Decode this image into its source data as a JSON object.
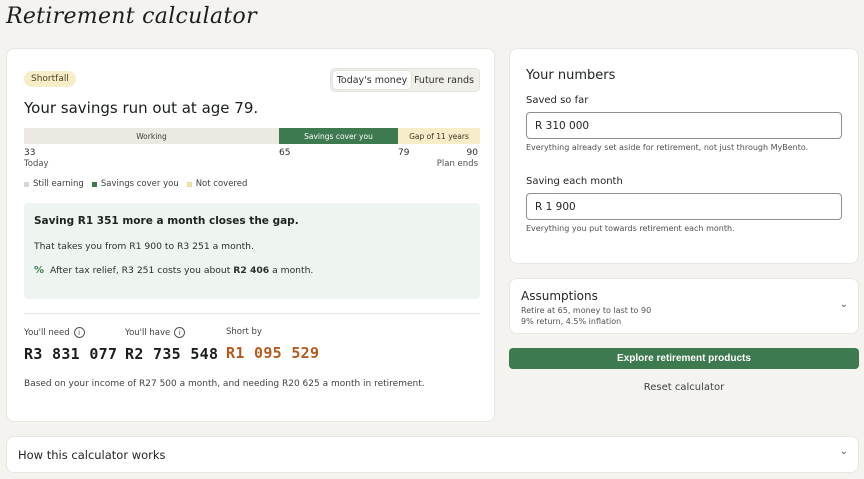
{
  "page": {
    "title": "Retirement calculator"
  },
  "main": {
    "badge": "Shortfall",
    "toggle": {
      "today": "Today's money",
      "future": "Future rands"
    },
    "headline": "Your savings run out at age 79.",
    "timeline": {
      "working_label": "Working",
      "cover_label": "Savings cover you",
      "gap_label": "Gap of 11 years",
      "ticks": {
        "start": "33",
        "start_sub": "Today",
        "retire": "65",
        "runout": "79",
        "end": "90",
        "end_sub": "Plan ends"
      }
    },
    "legend": {
      "earning": "Still earning",
      "cover": "Savings cover you",
      "notcovered": "Not covered"
    },
    "gap": {
      "title": "Saving R1 351 more a month closes the gap.",
      "line": "That takes you from R1 900 to R3 251 a month.",
      "tax_prefix": "After tax relief, R3 251 costs you about",
      "tax_amount": "R2 406",
      "tax_suffix": "a month."
    },
    "stats": {
      "need_label": "You'll need",
      "need_value": "R3 831 077",
      "have_label": "You'll have",
      "have_value": "R2 735 548",
      "short_label": "Short by",
      "short_value": "R1 095 529"
    },
    "based_on": "Based on your income of R27 500 a month, and needing R20 625 a month in retirement."
  },
  "numbers": {
    "title": "Your numbers",
    "saved_label": "Saved so far",
    "saved_value": "R 310 000",
    "saved_help": "Everything already set aside for retirement, not just through MyBento.",
    "monthly_label": "Saving each month",
    "monthly_value": "R 1 900",
    "monthly_help": "Everything you put towards retirement each month."
  },
  "assumptions": {
    "title": "Assumptions",
    "line1": "Retire at 65, money to last to 90",
    "line2": "9% return, 4.5% inflation"
  },
  "actions": {
    "explore": "Explore retirement products",
    "reset": "Reset calculator"
  },
  "how": {
    "title": "How this calculator works"
  },
  "colors": {
    "accent": "#3d7a4f",
    "gap": "#f7edc9",
    "short": "#b45a1f"
  }
}
